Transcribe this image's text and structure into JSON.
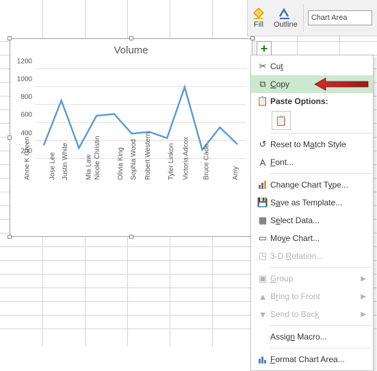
{
  "toolbar": {
    "fill_label": "Fill",
    "outline_label": "Outline",
    "dropdown_value": "Chart Area"
  },
  "add_element_label": "+",
  "chart_data": {
    "type": "line",
    "title": "Volume",
    "ylabel": "",
    "xlabel": "",
    "ylim": [
      0,
      1300
    ],
    "yticks": [
      200,
      400,
      600,
      800,
      1000,
      1200
    ],
    "categories": [
      "Anne K Green",
      "Jose Lee",
      "Justin White",
      "Mia Law",
      "Nicole Christin",
      "Olivia King",
      "Sophia Wood",
      "Robert Western",
      "Tyler Linkon",
      "Victoria Adcox",
      "Bruce Cade",
      "Amy"
    ],
    "series": [
      {
        "name": "Volume",
        "values": [
          350,
          850,
          320,
          680,
          700,
          480,
          500,
          430,
          1000,
          300,
          550,
          360
        ]
      }
    ],
    "color": "#5b9bd5"
  },
  "context_menu": {
    "cut": "Cut",
    "copy": "Copy",
    "paste_header": "Paste Options:",
    "reset": "Reset to Match Style",
    "font": "Font...",
    "change_type": "Change Chart Type...",
    "save_template": "Save as Template...",
    "select_data": "Select Data...",
    "move_chart": "Move Chart...",
    "rotation": "3-D Rotation...",
    "group": "Group",
    "bring_front": "Bring to Front",
    "send_back": "Send to Back",
    "assign_macro": "Assign Macro...",
    "format_area": "Format Chart Area..."
  }
}
